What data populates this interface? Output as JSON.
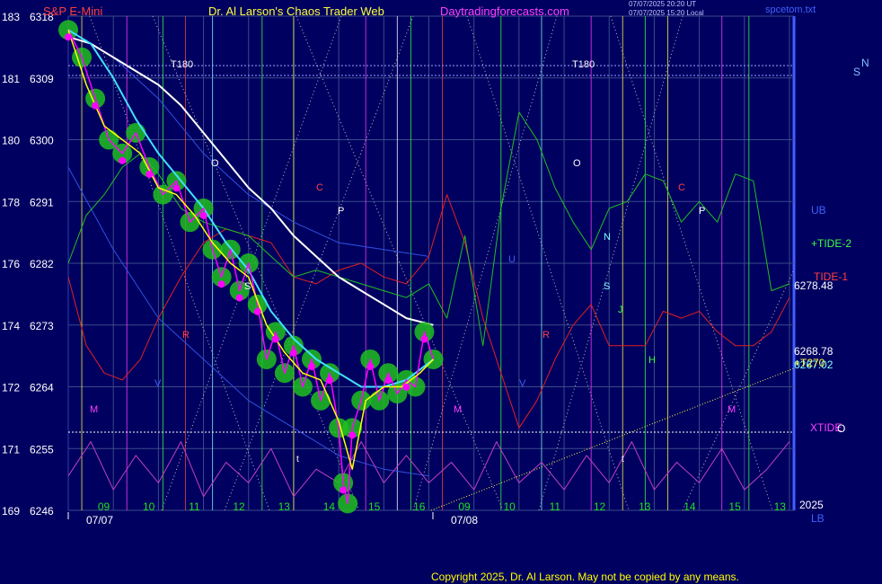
{
  "header": {
    "symbol": "S&P E-Mini",
    "title": "Dr. Al Larson's Chaos Trader Web",
    "site": "Daytradingforecasts.com",
    "ut_time": "07/07/2025 20:20 UT",
    "local_time": "07/07/2025 15:20 Local",
    "filename": "spcetom.txt"
  },
  "copyright": "Copyright 2025, Dr. Al Larson. May not be copied by any means.",
  "colors": {
    "background": "#000060",
    "grid": "#3a4a8a",
    "price": "#ff00ff",
    "smoothed": "#ffff00",
    "halo": "#20c020",
    "ma_fast": "#40e0ff",
    "ma_slow": "#ffffff",
    "tide2": "#20c020",
    "tide1": "#e02020",
    "xtide": "#c040c0",
    "band": "#3050e0"
  },
  "chart_data": {
    "type": "line",
    "title": "S&P E-Mini",
    "y_left_labels": [
      {
        "a": "183",
        "b": "6318"
      },
      {
        "a": "181",
        "b": "6309"
      },
      {
        "a": "180",
        "b": "6300"
      },
      {
        "a": "178",
        "b": "6291"
      },
      {
        "a": "176",
        "b": "6282"
      },
      {
        "a": "174",
        "b": "6273"
      },
      {
        "a": "172",
        "b": "6264"
      },
      {
        "a": "171",
        "b": "6255"
      },
      {
        "a": "169",
        "b": "6246"
      }
    ],
    "ylim": [
      6246,
      6318
    ],
    "x_hour_labels": [
      "09",
      "10",
      "11",
      "12",
      "13",
      "14",
      "15",
      "16",
      "09",
      "10",
      "11",
      "12",
      "13",
      "14",
      "15",
      "13"
    ],
    "date_labels": [
      "07/07",
      "07/08"
    ],
    "right_labels": {
      "ub": "UB",
      "tide2": "+TIDE-2",
      "tide1": "TIDE-1",
      "price_a": "6278.48",
      "price_b": "6268.78",
      "stack_a": "+T270",
      "stack_b": "6267.02",
      "xtide": "XTIDE",
      "year": "2025",
      "lb": "LB",
      "compass_s": "S",
      "compass_n": "N",
      "xtide_o": "O"
    },
    "annotations": {
      "t180": "T180",
      "o": "O",
      "c": "C",
      "p": "P",
      "s": "S",
      "n": "N",
      "u": "U",
      "j": "J",
      "r": "R",
      "v": "V",
      "h": "H",
      "m": "M",
      "t": "t"
    },
    "series": [
      {
        "name": "price",
        "x": [
          0,
          0.3,
          0.6,
          0.9,
          1.2,
          1.5,
          1.8,
          2.1,
          2.4,
          2.7,
          3,
          3.2,
          3.4,
          3.6,
          3.8,
          4,
          4.2,
          4.4,
          4.6,
          4.8,
          5,
          5.2,
          5.4,
          5.6,
          5.8,
          6,
          6.1,
          6.2,
          6.3,
          6.5,
          6.7,
          6.9,
          7.1,
          7.3,
          7.5,
          7.7,
          7.9,
          8.1
        ],
        "y": [
          6316,
          6312,
          6306,
          6300,
          6298,
          6301,
          6296,
          6292,
          6294,
          6288,
          6290,
          6284,
          6280,
          6284,
          6278,
          6282,
          6276,
          6268,
          6272,
          6266,
          6270,
          6264,
          6268,
          6262,
          6266,
          6258,
          6250,
          6247,
          6258,
          6262,
          6268,
          6262,
          6266,
          6263,
          6265,
          6264,
          6272,
          6268
        ]
      },
      {
        "name": "smoothed",
        "x": [
          0,
          0.4,
          0.8,
          1.2,
          1.6,
          2,
          2.4,
          2.8,
          3.2,
          3.6,
          4,
          4.4,
          4.8,
          5.2,
          5.6,
          6,
          6.3,
          6.6,
          7,
          7.4,
          7.8,
          8.1
        ],
        "y": [
          6316,
          6308,
          6302,
          6300,
          6298,
          6293,
          6292,
          6289,
          6285,
          6282,
          6280,
          6273,
          6269,
          6266,
          6265,
          6259,
          6252,
          6262,
          6264,
          6264,
          6266,
          6268
        ]
      },
      {
        "name": "ma_fast",
        "x": [
          0,
          0.5,
          1,
          1.5,
          2,
          2.5,
          3,
          3.5,
          4,
          4.5,
          5,
          5.5,
          6,
          6.5,
          7,
          7.5,
          8.1
        ],
        "y": [
          6316,
          6314,
          6309,
          6303,
          6298,
          6294,
          6290,
          6285,
          6281,
          6275,
          6271,
          6268,
          6266,
          6264,
          6264,
          6265,
          6268
        ]
      },
      {
        "name": "ma_slow",
        "x": [
          0,
          0.5,
          1,
          1.5,
          2,
          2.5,
          3,
          3.5,
          4,
          4.5,
          5,
          5.5,
          6,
          6.5,
          7,
          7.5,
          8.1
        ],
        "y": [
          6315,
          6314,
          6312,
          6310,
          6308,
          6305,
          6301,
          6297,
          6293,
          6290,
          6286,
          6283,
          6280,
          6278,
          6276,
          6274,
          6273
        ]
      },
      {
        "name": "+TIDE-2",
        "x": [
          0,
          0.4,
          0.8,
          1.2,
          1.6,
          2,
          2.5,
          3,
          3.5,
          4,
          4.5,
          5,
          5.5,
          6,
          6.5,
          7,
          7.5,
          8,
          8.4,
          8.8,
          9.2,
          9.6,
          10,
          10.4,
          10.8,
          11.2,
          11.6,
          12,
          12.4,
          12.8,
          13.2,
          13.6,
          14,
          14.4,
          14.8,
          15.2,
          15.6,
          16
        ],
        "y": [
          6282,
          6289,
          6292,
          6296,
          6298,
          6295,
          6290,
          6288,
          6287,
          6286,
          6283,
          6280,
          6281,
          6280,
          6279,
          6278,
          6277,
          6279,
          6274,
          6286,
          6270,
          6290,
          6304,
          6300,
          6293,
          6288,
          6284,
          6290,
          6291,
          6295,
          6294,
          6288,
          6291,
          6288,
          6295,
          6294,
          6278,
          6279
        ]
      },
      {
        "name": "TIDE-1",
        "x": [
          0,
          0.4,
          0.8,
          1.2,
          1.6,
          2,
          2.5,
          3,
          3.5,
          4,
          4.5,
          5,
          5.5,
          6,
          6.5,
          7,
          7.5,
          8,
          8.4,
          8.8,
          9.2,
          9.6,
          10,
          10.4,
          10.8,
          11.2,
          11.6,
          12,
          12.4,
          12.8,
          13.2,
          13.6,
          14,
          14.4,
          14.8,
          15.2,
          15.6,
          16
        ],
        "y": [
          6280,
          6270,
          6266,
          6265,
          6268,
          6274,
          6280,
          6285,
          6287,
          6286,
          6285,
          6280,
          6279,
          6281,
          6282,
          6280,
          6279,
          6283,
          6292,
          6285,
          6274,
          6266,
          6258,
          6262,
          6268,
          6273,
          6276,
          6270,
          6270,
          6270,
          6275,
          6274,
          6275,
          6272,
          6270,
          6270,
          6272,
          6277
        ]
      },
      {
        "name": "XTIDE",
        "x": [
          0,
          0.5,
          1,
          1.5,
          2,
          2.5,
          3,
          3.5,
          4,
          4.5,
          5,
          5.5,
          6,
          6.5,
          7,
          7.5,
          8,
          8.5,
          9,
          9.5,
          10,
          10.5,
          11,
          11.5,
          12,
          12.5,
          13,
          13.5,
          14,
          14.5,
          15,
          15.5,
          16
        ],
        "y": [
          6251,
          6256,
          6249,
          6254,
          6250,
          6256,
          6248,
          6253,
          6250,
          6255,
          6248,
          6252,
          6250,
          6256,
          6250,
          6254,
          6250,
          6253,
          6249,
          6256,
          6250,
          6253,
          6249,
          6254,
          6250,
          6256,
          6249,
          6253,
          6250,
          6255,
          6249,
          6252,
          6256
        ]
      },
      {
        "name": "UB",
        "x": [
          0,
          1,
          2,
          3,
          4,
          5,
          6,
          7,
          8
        ],
        "y": [
          6316,
          6312,
          6306,
          6298,
          6292,
          6288,
          6285,
          6284,
          6283
        ]
      },
      {
        "name": "LB",
        "x": [
          0,
          1,
          2,
          3,
          4,
          5,
          6,
          7,
          8
        ],
        "y": [
          6296,
          6284,
          6274,
          6268,
          6262,
          6258,
          6254,
          6252,
          6251
        ]
      }
    ]
  }
}
